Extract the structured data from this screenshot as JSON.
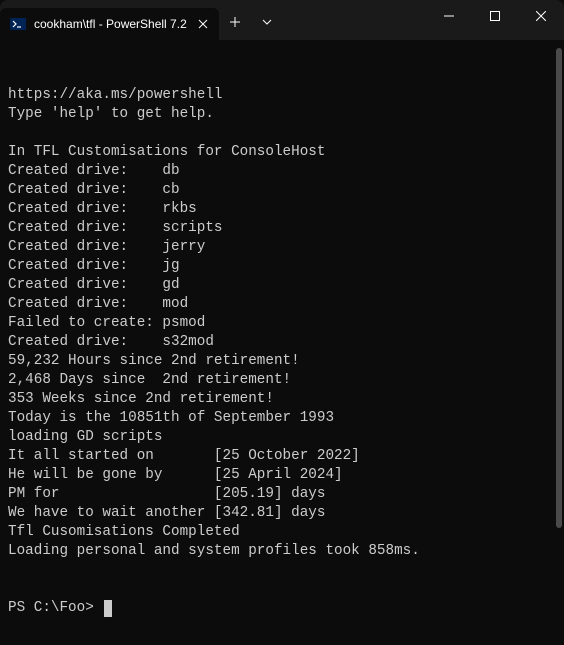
{
  "window": {
    "tab_title": "cookham\\tfl - PowerShell 7.2"
  },
  "terminal": {
    "lines": [
      "https://aka.ms/powershell",
      "Type 'help' to get help.",
      "",
      "In TFL Customisations for ConsoleHost",
      "Created drive:    db",
      "Created drive:    cb",
      "Created drive:    rkbs",
      "Created drive:    scripts",
      "Created drive:    jerry",
      "Created drive:    jg",
      "Created drive:    gd",
      "Created drive:    mod",
      "Failed to create: psmod",
      "Created drive:    s32mod",
      "59,232 Hours since 2nd retirement!",
      "2,468 Days since  2nd retirement!",
      "353 Weeks since 2nd retirement!",
      "Today is the 10851th of September 1993",
      "loading GD scripts",
      "It all started on       [25 October 2022]",
      "He will be gone by      [25 April 2024]",
      "PM for                  [205.19] days",
      "We have to wait another [342.81] days",
      "Tfl Cusomisations Completed",
      "Loading personal and system profiles took 858ms."
    ],
    "prompt": "PS C:\\Foo> "
  }
}
